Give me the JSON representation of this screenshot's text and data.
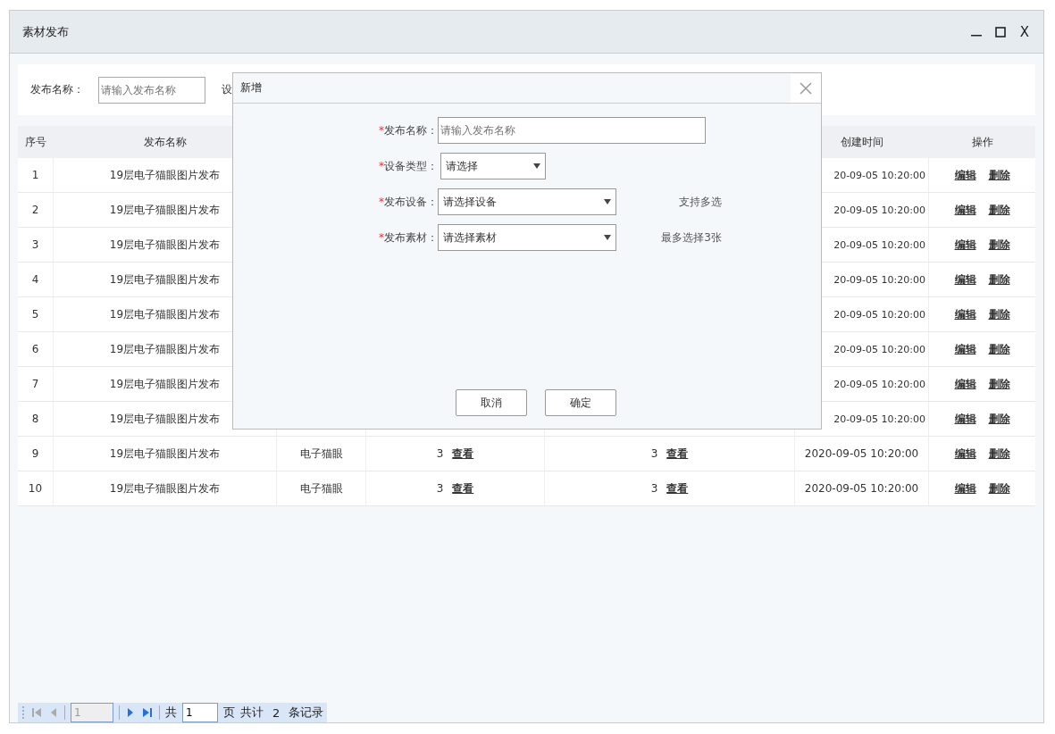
{
  "window": {
    "title": "素材发布",
    "close_glyph": "X"
  },
  "search": {
    "label": "发布名称：",
    "placeholder": "请输入发布名称",
    "next_label": "设"
  },
  "table": {
    "columns": [
      "序号",
      "发布名称",
      "创建时间",
      "操作"
    ],
    "rows": [
      {
        "index": "1",
        "name": "19层电子猫眼图片发布",
        "time": "20-09-05 10:20:00",
        "actions": [
          "编辑",
          "删除"
        ]
      },
      {
        "index": "2",
        "name": "19层电子猫眼图片发布",
        "time": "20-09-05 10:20:00",
        "actions": [
          "编辑",
          "删除"
        ]
      },
      {
        "index": "3",
        "name": "19层电子猫眼图片发布",
        "time": "20-09-05 10:20:00",
        "actions": [
          "编辑",
          "删除"
        ]
      },
      {
        "index": "4",
        "name": "19层电子猫眼图片发布",
        "time": "20-09-05 10:20:00",
        "actions": [
          "编辑",
          "删除"
        ]
      },
      {
        "index": "5",
        "name": "19层电子猫眼图片发布",
        "time": "20-09-05 10:20:00",
        "actions": [
          "编辑",
          "删除"
        ]
      },
      {
        "index": "6",
        "name": "19层电子猫眼图片发布",
        "time": "20-09-05 10:20:00",
        "actions": [
          "编辑",
          "删除"
        ]
      },
      {
        "index": "7",
        "name": "19层电子猫眼图片发布",
        "time": "20-09-05 10:20:00",
        "actions": [
          "编辑",
          "删除"
        ]
      },
      {
        "index": "8",
        "name": "19层电子猫眼图片发布",
        "time": "20-09-05 10:20:00",
        "actions": [
          "编辑",
          "删除"
        ]
      },
      {
        "index": "9",
        "name": "19层电子猫眼图片发布",
        "device_type": "电子猫眼",
        "device_count": "3",
        "device_link": "查看",
        "material_count": "3",
        "material_link": "查看",
        "time": "2020-09-05 10:20:00",
        "actions": [
          "编辑",
          "删除"
        ]
      },
      {
        "index": "10",
        "name": "19层电子猫眼图片发布",
        "device_type": "电子猫眼",
        "device_count": "3",
        "device_link": "查看",
        "material_count": "3",
        "material_link": "查看",
        "time": "2020-09-05 10:20:00",
        "actions": [
          "编辑",
          "删除"
        ]
      }
    ]
  },
  "dialog": {
    "title": "新增",
    "fields": [
      {
        "kind": "input",
        "required_mark": "*",
        "label": "发布名称：",
        "placeholder": "请输入发布名称"
      },
      {
        "kind": "short-select",
        "required_mark": "*",
        "label": "设备类型：",
        "value": "请选择"
      },
      {
        "kind": "select",
        "required_mark": "*",
        "label": "发布设备：",
        "value": "请选择设备",
        "note": "支持多选"
      },
      {
        "kind": "select",
        "required_mark": "*",
        "label": "发布素材：",
        "value": "请选择素材",
        "note": "最多选择3张"
      }
    ],
    "buttons": [
      "取消",
      "确定"
    ]
  },
  "pagination": {
    "first": {
      "disabled": true
    },
    "prev": {
      "disabled": true
    },
    "current_page": "1",
    "page_field_disabled": true,
    "next": {
      "disabled": false
    },
    "last": {
      "disabled": false
    },
    "of_label": "共",
    "total_pages": "1",
    "pages_label": "页",
    "total_label": "共计",
    "total_records": "2",
    "records_label": "条记录"
  }
}
